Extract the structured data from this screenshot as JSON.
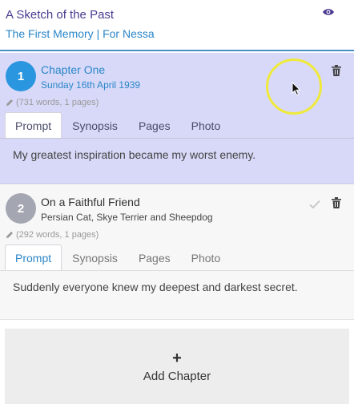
{
  "book": {
    "title": "A Sketch of the Past",
    "subtitle": "The First Memory | For Nessa"
  },
  "icons": {
    "eye": "eye-icon",
    "pencil": "pencil-icon",
    "check": "check-icon",
    "trash": "trash-icon",
    "plus": "plus-icon"
  },
  "colors": {
    "accent": "#2a86c9",
    "title": "#4b3a91",
    "selected_bg": "#d8d9f8"
  },
  "chapters": [
    {
      "number": "1",
      "title": "Chapter One",
      "subtitle": "Sunday 16th April 1939",
      "stats": "(731 words, 1 pages)",
      "tabs": [
        "Prompt",
        "Synopsis",
        "Pages",
        "Photo"
      ],
      "active_tab": "Prompt",
      "prompt": "My greatest inspiration became my worst enemy."
    },
    {
      "number": "2",
      "title": "On a Faithful Friend",
      "subtitle": "Persian Cat, Skye Terrier and Sheepdog",
      "stats": "(292 words, 1 pages)",
      "tabs": [
        "Prompt",
        "Synopsis",
        "Pages",
        "Photo"
      ],
      "active_tab": "Prompt",
      "prompt": "Suddenly everyone knew my deepest and darkest secret."
    }
  ],
  "add_chapter": {
    "plus": "+",
    "label": "Add Chapter"
  }
}
